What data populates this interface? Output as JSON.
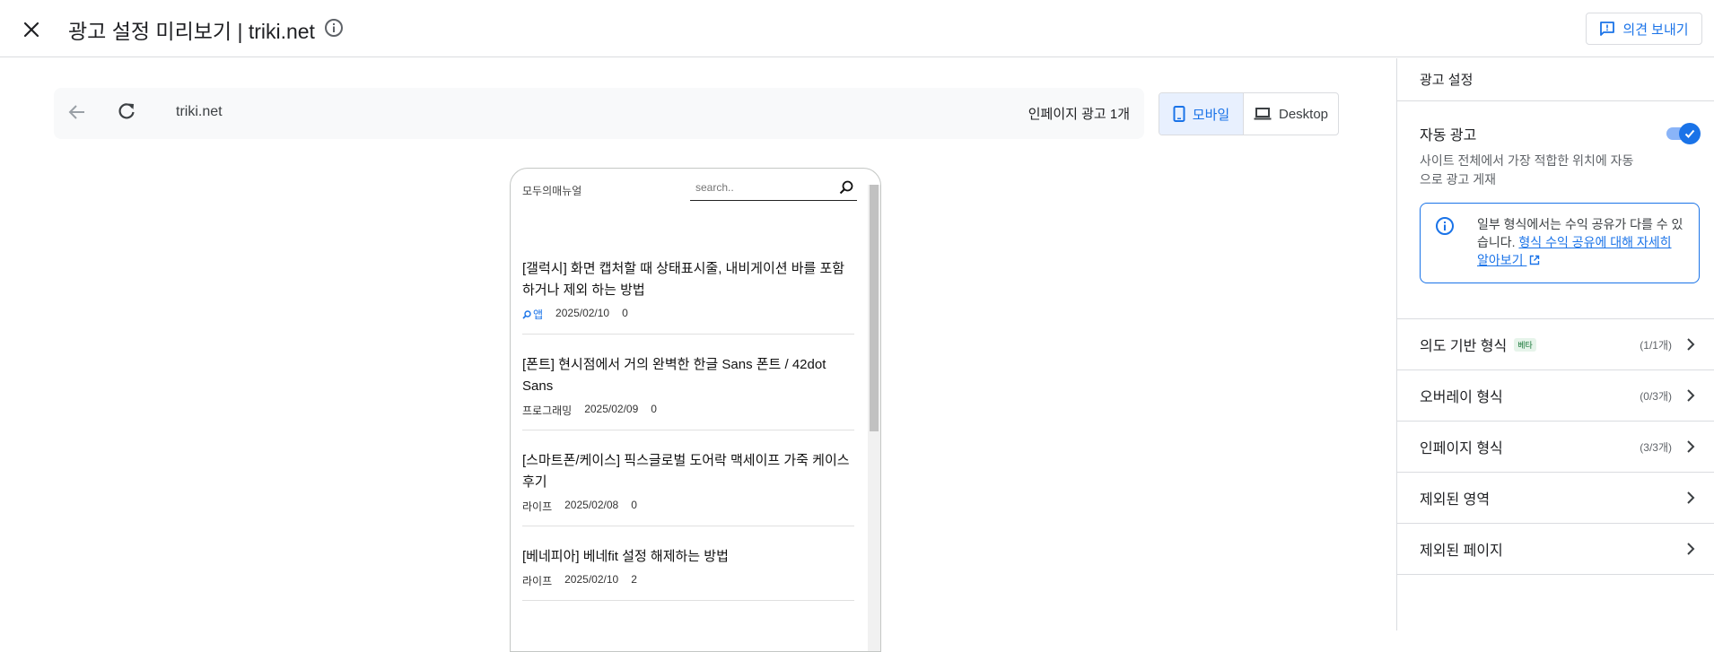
{
  "header": {
    "title": "광고 설정 미리보기 | triki.net",
    "feedback_label": "의견 보내기"
  },
  "browser": {
    "url": "triki.net",
    "inpage_count": "인페이지 광고 1개",
    "device_mobile": "모바일",
    "device_desktop": "Desktop",
    "selected_device": "mobile"
  },
  "site": {
    "name": "모두의매뉴얼",
    "search_placeholder": "search..",
    "posts": [
      {
        "title": "[갤럭시] 화면 캡처할 때 상태표시줄, 내비게이션 바를 포함하거나 제외 하는 방법",
        "category": "앱",
        "category_is_link": true,
        "date": "2025/02/10",
        "comments": "0"
      },
      {
        "title": "[폰트] 현시점에서 거의 완벽한 한글 Sans 폰트 / 42dot Sans",
        "category": "프로그래밍",
        "category_is_link": false,
        "date": "2025/02/09",
        "comments": "0"
      },
      {
        "title": "[스마트폰/케이스] 픽스글로벌 도어락 맥세이프 가죽 케이스 후기",
        "category": "라이프",
        "category_is_link": false,
        "date": "2025/02/08",
        "comments": "0"
      },
      {
        "title": "[베네피아] 베네fit 설정 해제하는 방법",
        "category": "라이프",
        "category_is_link": false,
        "date": "2025/02/10",
        "comments": "2"
      }
    ]
  },
  "panel": {
    "title": "광고 설정",
    "auto_ads": {
      "label": "자동 광고",
      "description": "사이트 전체에서 가장 적합한 위치에 자동으로 광고 게재",
      "enabled": true
    },
    "info_box": {
      "text": "일부 형식에서는 수익 공유가 다를 수 있습니다. ",
      "link": "형식 수익 공유에 대해 자세히 알아보기"
    },
    "rows": [
      {
        "label": "의도 기반 형식",
        "badge": "베타",
        "count": "(1/1개)"
      },
      {
        "label": "오버레이 형식",
        "badge": "",
        "count": "(0/3개)"
      },
      {
        "label": "인페이지 형식",
        "badge": "",
        "count": "(3/3개)"
      },
      {
        "label": "제외된 영역",
        "badge": "",
        "count": ""
      },
      {
        "label": "제외된 페이지",
        "badge": "",
        "count": ""
      }
    ]
  },
  "colors": {
    "accent": "#1a73e8",
    "toggle_track": "#8ab4f8",
    "device_selected_bg": "#e8f0fe",
    "beta_badge_bg": "#e6f4ea"
  },
  "icons": [
    "close-icon",
    "info-icon",
    "feedback-icon",
    "back-arrow-icon",
    "reload-icon",
    "phone-icon",
    "laptop-icon",
    "search-icon",
    "check-icon",
    "external-link-icon",
    "chevron-right-icon"
  ]
}
